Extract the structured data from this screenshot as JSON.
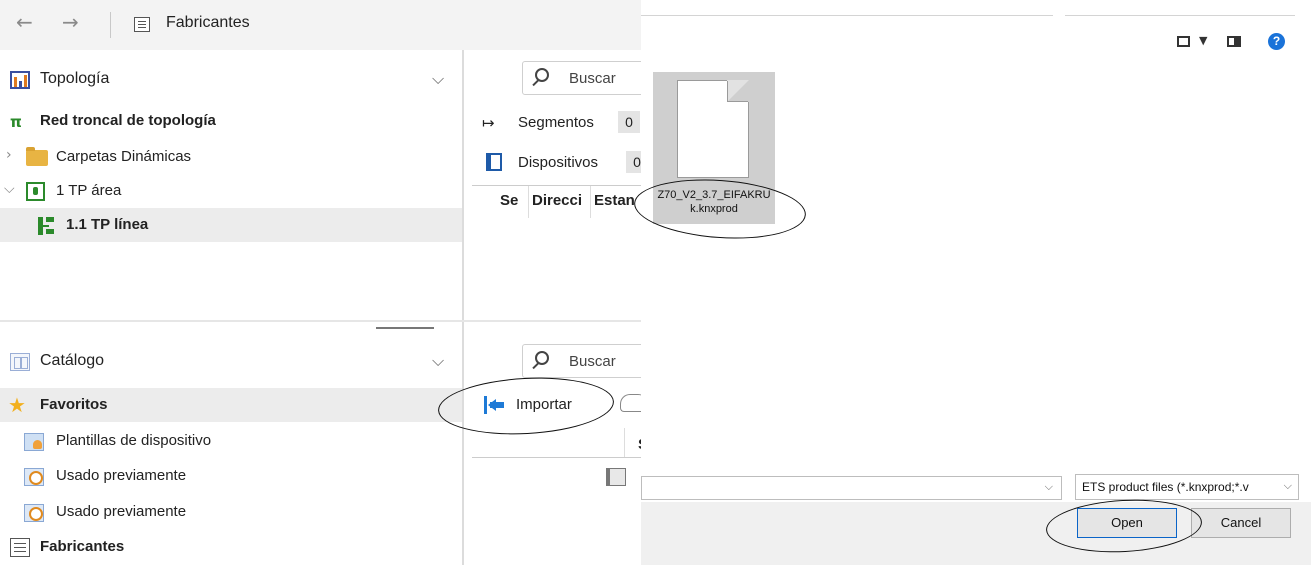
{
  "ets": {
    "nav": {
      "back_glyph": "←",
      "forward_glyph": "→",
      "title": "Fabricantes",
      "title_icon": "catalog-list-icon"
    },
    "topology_panel": {
      "title": "Topología",
      "icon": "topology-icon",
      "items": [
        {
          "label": "Red troncal de topología",
          "icon": "backbone-icon"
        },
        {
          "label": "Carpetas Dinámicas",
          "icon": "folder-icon"
        },
        {
          "label": "1 TP área",
          "icon": "area-icon"
        },
        {
          "label": "1.1 TP línea",
          "icon": "line-icon"
        }
      ]
    },
    "topology_detail": {
      "search_placeholder": "Buscar",
      "segments_label": "Segmentos",
      "segments_count": "0",
      "devices_label": "Dispositivos",
      "devices_count": "0",
      "columns": [
        "Se",
        "Direcci",
        "Estan"
      ]
    },
    "catalog_panel": {
      "title": "Catálogo",
      "icon": "catalog-icon",
      "items": [
        {
          "label": "Favoritos",
          "icon": "star-icon"
        },
        {
          "label": "Plantillas de dispositivo",
          "icon": "template-icon"
        },
        {
          "label": "Usado previamente",
          "icon": "recent-icon"
        },
        {
          "label": "Usado previamente",
          "icon": "recent-icon"
        },
        {
          "label": "Fabricantes",
          "icon": "manufacturers-icon"
        }
      ]
    },
    "catalog_detail": {
      "search_placeholder": "Buscar",
      "import_label": "Importar",
      "column_fragment": "S"
    },
    "colors": {
      "green": "#2b8a2b",
      "blue": "#1e7ad6",
      "selected_row": "#ececec"
    }
  },
  "dialog": {
    "file": {
      "name": "Z70_V2_3.7_EIFAKRUk.knxprod"
    },
    "file_type_filter": "ETS product files (*.knxprod;*.v",
    "open_label": "Open",
    "cancel_label": "Cancel",
    "help_glyph": "?",
    "accent": "#1a73d9"
  }
}
